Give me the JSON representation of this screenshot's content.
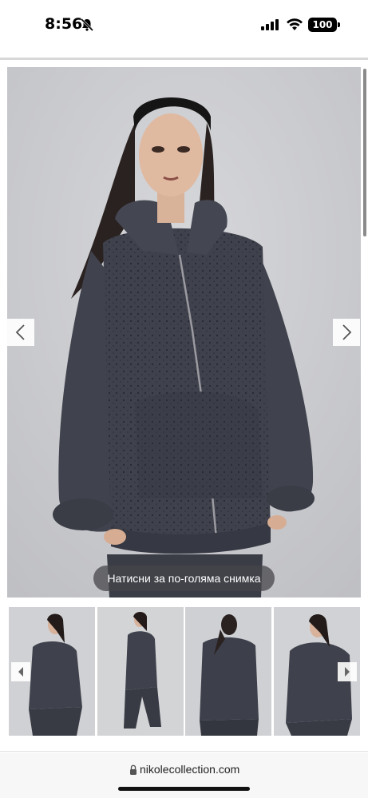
{
  "status_bar": {
    "time": "8:56",
    "battery": "100",
    "icons": [
      "bell-off-icon",
      "signal-icon",
      "wifi-icon",
      "battery-icon"
    ]
  },
  "gallery": {
    "main_image_alt": "",
    "zoom_hint": "Натисни за по-голяма снимка",
    "prev_icon": "chevron-left-icon",
    "next_icon": "chevron-right-icon",
    "thumbnails": [
      "",
      "",
      "",
      ""
    ]
  },
  "browser": {
    "url": "nikolecollection.com",
    "lock_icon": "lock-icon"
  },
  "colors": {
    "garment": "#3d3f4a",
    "background": "#c9cacd",
    "overlay": "#46464b"
  }
}
